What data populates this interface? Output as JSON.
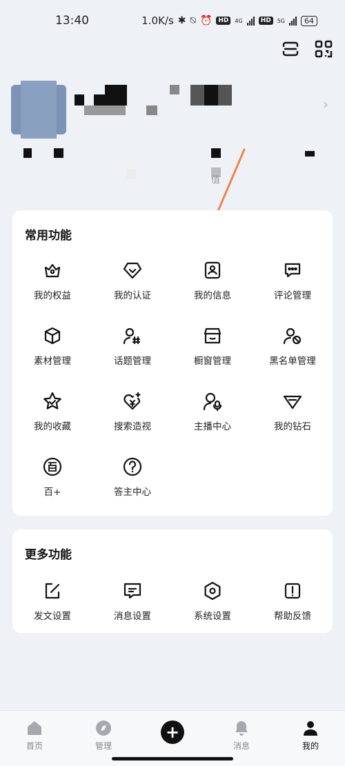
{
  "status_bar": {
    "time": "13:40",
    "speed": "1.0K/s",
    "hd_label": "HD",
    "net1": "4G",
    "net2": "5G",
    "battery": "64"
  },
  "profile": {
    "stat_fragment": "值"
  },
  "common_section": {
    "title": "常用功能",
    "items": [
      {
        "label": "我的权益",
        "icon": "crown-icon"
      },
      {
        "label": "我的认证",
        "icon": "verified-badge-icon"
      },
      {
        "label": "我的信息",
        "icon": "id-card-icon"
      },
      {
        "label": "评论管理",
        "icon": "comment-icon"
      },
      {
        "label": "素材管理",
        "icon": "cube-icon"
      },
      {
        "label": "话题管理",
        "icon": "topic-user-icon"
      },
      {
        "label": "橱窗管理",
        "icon": "shop-window-icon"
      },
      {
        "label": "黑名单管理",
        "icon": "block-user-icon"
      },
      {
        "label": "我的收藏",
        "icon": "star-icon"
      },
      {
        "label": "搜索造视",
        "icon": "spark-heart-icon"
      },
      {
        "label": "主播中心",
        "icon": "anchor-mic-icon"
      },
      {
        "label": "我的钻石",
        "icon": "diamond-icon"
      },
      {
        "label": "百+",
        "icon": "bai-plus-icon"
      },
      {
        "label": "答主中心",
        "icon": "question-icon"
      }
    ]
  },
  "more_section": {
    "title": "更多功能",
    "items": [
      {
        "label": "发文设置",
        "icon": "edit-icon"
      },
      {
        "label": "消息设置",
        "icon": "message-icon"
      },
      {
        "label": "系统设置",
        "icon": "settings-hexagon-icon"
      },
      {
        "label": "帮助反馈",
        "icon": "feedback-icon"
      }
    ]
  },
  "bottom_nav": {
    "items": [
      {
        "label": "首页",
        "icon": "home-icon"
      },
      {
        "label": "管理",
        "icon": "compass-icon"
      },
      {
        "label": "",
        "icon": "plus-icon"
      },
      {
        "label": "消息",
        "icon": "bell-icon"
      },
      {
        "label": "我的",
        "icon": "user-icon"
      }
    ]
  },
  "colors": {
    "background": "#eef1f6",
    "card": "#ffffff",
    "arrow": "#f0844a",
    "text": "#1a1a1a"
  }
}
